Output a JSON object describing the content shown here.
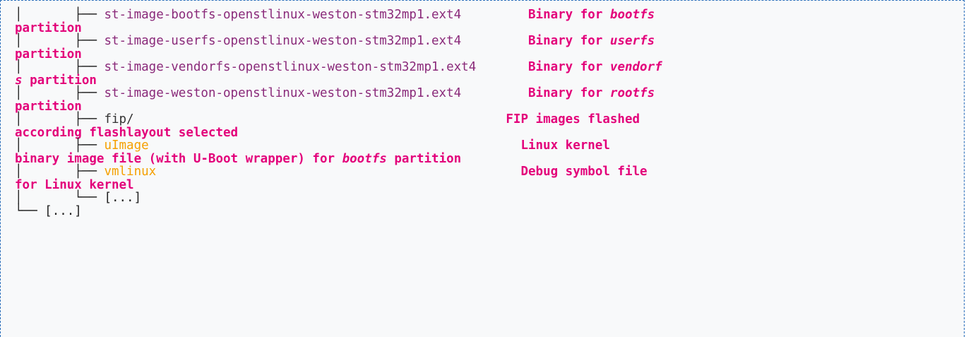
{
  "colors": {
    "border": "#2a6ebb",
    "background": "#f8f9fa",
    "comment": "#e3007a",
    "file": "#8a2a7a",
    "kernel_file": "#f5a000",
    "tree": "#222222"
  },
  "rows": [
    {
      "tree": "│       ├── ",
      "name": "st-image-bootfs-openstlinux-weston-stm32mp1.ext4",
      "pad": "         ",
      "c1": "Binary for ",
      "c2": "bootfs",
      "wrap_pre": "",
      "wrap_em": "",
      "wrap_post": "partition"
    },
    {
      "tree": "│       ├── ",
      "name": "st-image-userfs-openstlinux-weston-stm32mp1.ext4",
      "pad": "         ",
      "c1": "Binary for ",
      "c2": "userfs",
      "wrap_pre": "",
      "wrap_em": "",
      "wrap_post": "partition"
    },
    {
      "tree": "│       ├── ",
      "name": "st-image-vendorfs-openstlinux-weston-stm32mp1.ext4",
      "pad": "       ",
      "c1": "Binary for ",
      "c2": "vendorf",
      "wrap_pre": "",
      "wrap_em": "s",
      "wrap_post": " partition"
    },
    {
      "tree": "│       ├── ",
      "name": "st-image-weston-openstlinux-weston-stm32mp1.ext4",
      "pad": "         ",
      "c1": "Binary for ",
      "c2": "rootfs",
      "wrap_pre": "",
      "wrap_em": "",
      "wrap_post": "partition"
    },
    {
      "tree": "│       ├── ",
      "name": "fip/",
      "pad": "                                                  ",
      "c1": "FIP images flashed",
      "c2": "",
      "wrap_pre": "according flashlayout selected",
      "wrap_em": "",
      "wrap_post": ""
    },
    {
      "tree": "│       ├── ",
      "name": "uImage",
      "pad": "                                                  ",
      "c1": "Linux kernel",
      "c2": "",
      "wrap_pre": "binary image file (with U-Boot wrapper) for ",
      "wrap_em": "bootfs",
      "wrap_post": " partition"
    },
    {
      "tree": "│       ├── ",
      "name": "vmlinux",
      "pad": "                                                 ",
      "c1": "Debug symbol file",
      "c2": "",
      "wrap_pre": "for Linux kernel",
      "wrap_em": "",
      "wrap_post": ""
    }
  ],
  "tail": [
    {
      "tree": "│       └── ",
      "text": "[...]"
    },
    {
      "tree": "└── ",
      "text": "[...]"
    }
  ]
}
